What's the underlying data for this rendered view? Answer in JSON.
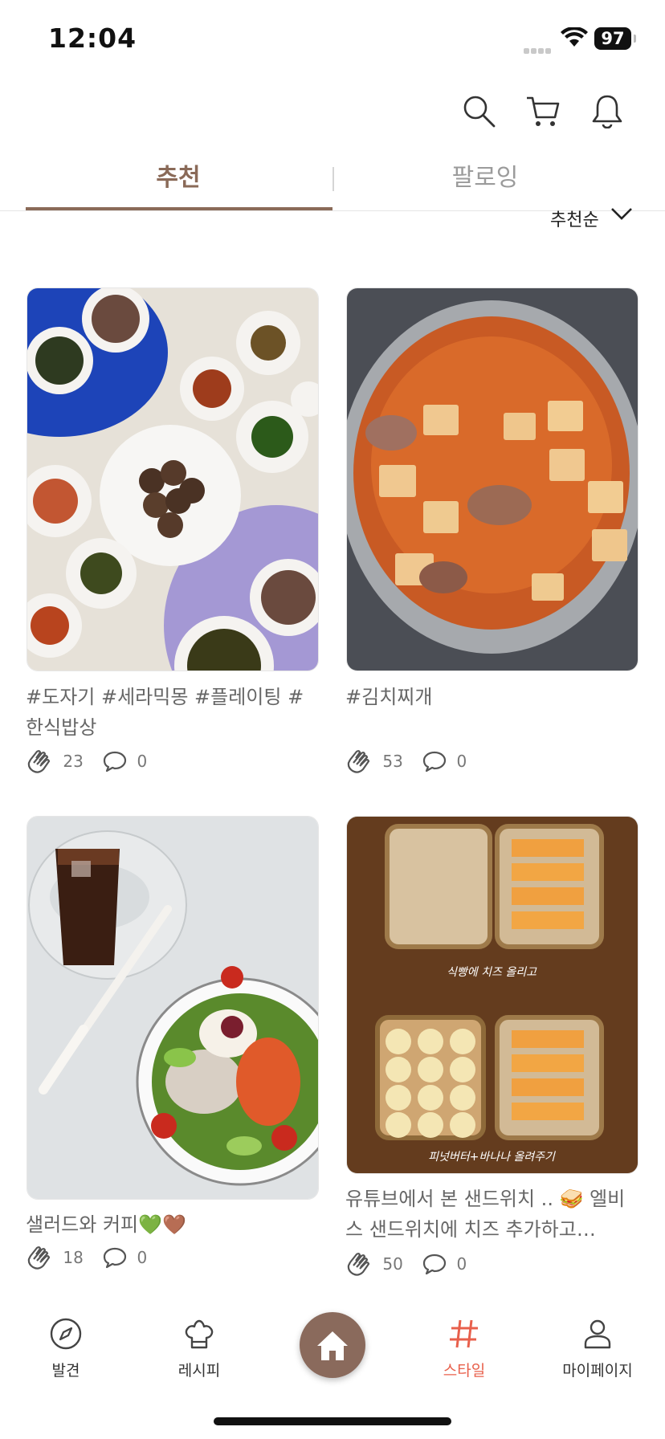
{
  "status": {
    "time": "12:04",
    "battery": "97"
  },
  "header": {
    "icons": [
      "search-icon",
      "cart-icon",
      "bell-icon"
    ]
  },
  "tabs": [
    {
      "label": "추천",
      "active": true
    },
    {
      "label": "팔로잉",
      "active": false
    }
  ],
  "sort": {
    "label": "추천순"
  },
  "posts": [
    {
      "caption": "#도자기 #세라믹몽 #플레이팅 #한식밥상",
      "claps": "23",
      "comments": "0"
    },
    {
      "caption": "#김치찌개",
      "claps": "53",
      "comments": "0"
    },
    {
      "caption": "샐러드와 커피💚🤎",
      "claps": "18",
      "comments": "0"
    },
    {
      "caption": "유튜브에서 본 샌드위치 .. 🥪 엘비스 샌드위치에 치즈 추가하고…",
      "claps": "50",
      "comments": "0",
      "image_text": {
        "top": "식빵에 치즈 올리고",
        "bottom": "피넛버터+바나나 올려주기"
      }
    }
  ],
  "nav": {
    "items": [
      {
        "label": "발견",
        "icon": "compass-icon"
      },
      {
        "label": "레시피",
        "icon": "chef-hat-icon"
      },
      {
        "label": "",
        "icon": "home-icon"
      },
      {
        "label": "스타일",
        "icon": "hashtag-icon"
      },
      {
        "label": "마이페이지",
        "icon": "person-icon"
      }
    ]
  },
  "colors": {
    "accent": "#8a6a58",
    "active_nav": "#e8604c",
    "home": "#8a6a5c"
  }
}
